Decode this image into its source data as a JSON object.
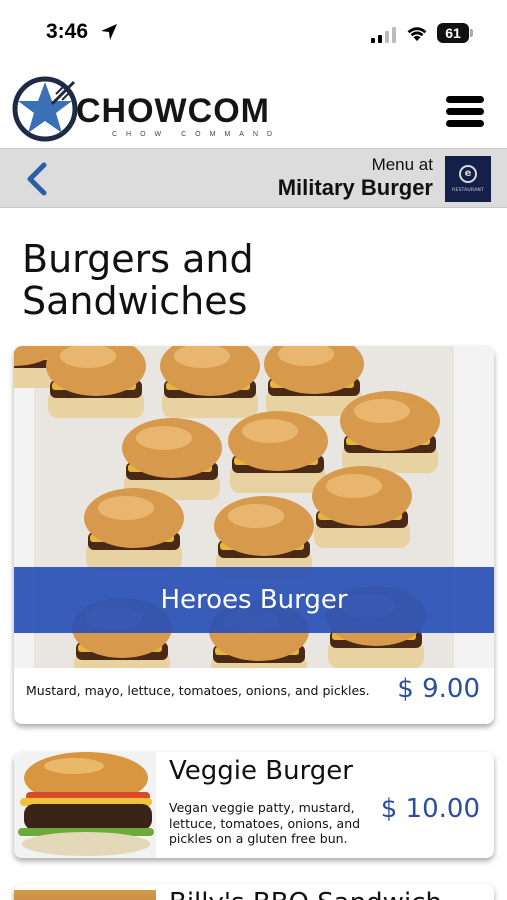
{
  "status_bar": {
    "time": "3:46",
    "battery": "61",
    "icons": [
      "location-arrow-icon",
      "signal-icon",
      "wifi-icon",
      "battery-icon"
    ]
  },
  "header": {
    "logo_text": "CHOWCOM",
    "logo_subtitle": "CHOW COMMAND",
    "menu_icon": "hamburger-menu-icon"
  },
  "sub_header": {
    "back_icon": "chevron-left-icon",
    "menu_at_label": "Menu at",
    "restaurant_name": "Military Burger",
    "restaurant_logo_text": "RESTAURANT"
  },
  "section": {
    "title": "Burgers and Sandwiches"
  },
  "items": [
    {
      "name": "Heroes Burger",
      "description": "Mustard, mayo, lettuce, tomatoes, onions, and pickles.",
      "price": "$ 9.00"
    },
    {
      "name": "Veggie Burger",
      "description": "Vegan veggie patty, mustard, lettuce, tomatoes, onions, and pickles on a gluten free bun.",
      "price": "$ 10.00"
    },
    {
      "name": "Billy's BBQ Sandwich"
    }
  ],
  "colors": {
    "accent_blue": "#2b4f9e",
    "banner_blue": "#2850b6",
    "subheader_bg": "#dcdcdc",
    "logo_navy": "#14204a"
  }
}
